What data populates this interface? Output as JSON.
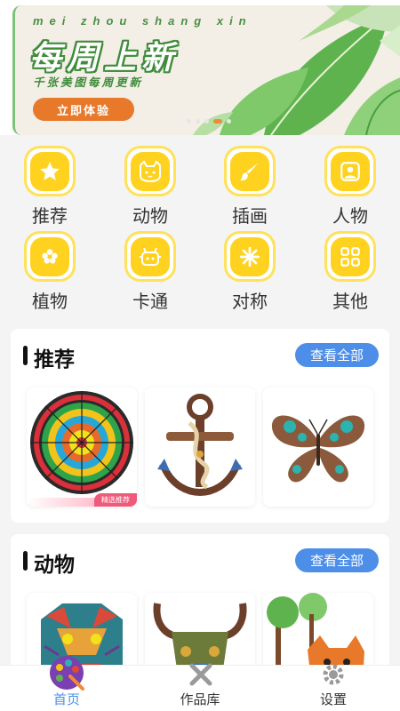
{
  "banner": {
    "sub_en": "mei zhou shang xin",
    "title": "每周上新",
    "desc": "千张美图每周更新",
    "button": "立即体验"
  },
  "categories": [
    {
      "label": "推荐",
      "icon": "star-icon"
    },
    {
      "label": "动物",
      "icon": "cat-icon"
    },
    {
      "label": "插画",
      "icon": "brush-icon"
    },
    {
      "label": "人物",
      "icon": "person-icon"
    },
    {
      "label": "植物",
      "icon": "flower-icon"
    },
    {
      "label": "卡通",
      "icon": "robot-icon"
    },
    {
      "label": "对称",
      "icon": "symmetry-icon"
    },
    {
      "label": "其他",
      "icon": "grid-icon"
    }
  ],
  "sections": [
    {
      "title": "推荐",
      "more": "查看全部",
      "items": [
        {
          "name": "mandala",
          "tag": "精选推荐"
        },
        {
          "name": "anchor"
        },
        {
          "name": "butterfly"
        }
      ]
    },
    {
      "title": "动物",
      "more": "查看全部",
      "items": [
        {
          "name": "tiger"
        },
        {
          "name": "bull"
        },
        {
          "name": "fox-tree"
        }
      ]
    }
  ],
  "nav": [
    {
      "label": "首页",
      "icon": "palette-icon",
      "active": true
    },
    {
      "label": "作品库",
      "icon": "tools-icon",
      "active": false
    },
    {
      "label": "设置",
      "icon": "gear-icon",
      "active": false
    }
  ],
  "colors": {
    "accent": "#4d8fe8",
    "category_yellow": "#ffd21f",
    "banner_green": "#3f8c3a",
    "banner_orange": "#e8782a"
  }
}
